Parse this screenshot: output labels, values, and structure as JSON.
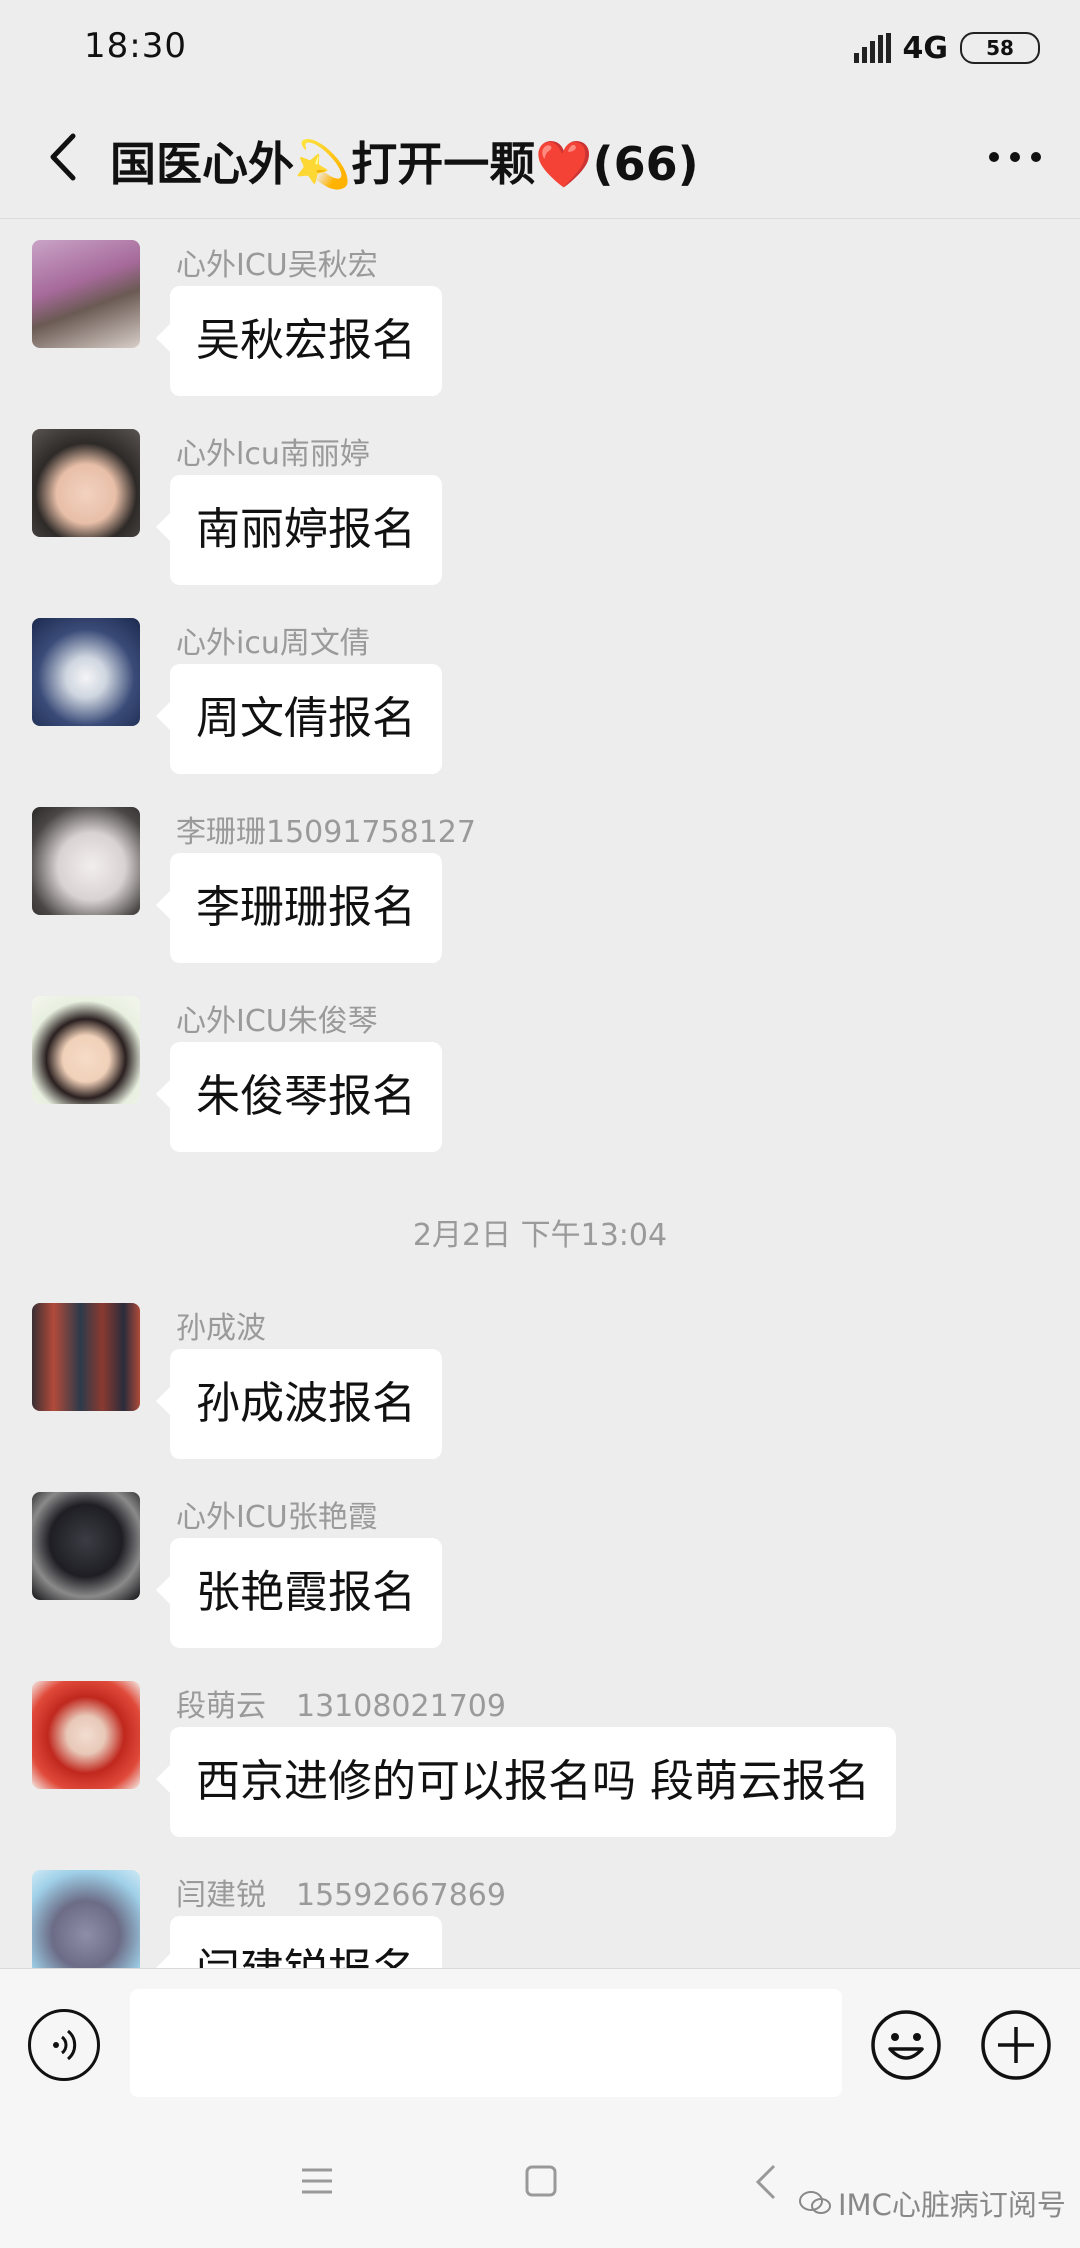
{
  "status_bar": {
    "time": "18:30",
    "network": "4G",
    "battery": "58"
  },
  "header": {
    "title": "国医心外💫打开一颗❤️(66)"
  },
  "messages": [
    {
      "sender": "心外ICU吴秋宏",
      "text": "吴秋宏报名"
    },
    {
      "sender": "心外lcu南丽婷",
      "text": "南丽婷报名"
    },
    {
      "sender": "心外icu周文倩",
      "text": "周文倩报名"
    },
    {
      "sender": "李珊珊15091758127",
      "text": "李珊珊报名"
    },
    {
      "sender": "心外ICU朱俊琴",
      "text": "朱俊琴报名"
    },
    {
      "sender": "孙成波",
      "text": "孙成波报名"
    },
    {
      "sender": "心外ICU张艳霞",
      "text": "张艳霞报名"
    },
    {
      "sender": "段萌云　13108021709",
      "text": "西京进修的可以报名吗  段萌云报名"
    },
    {
      "sender": "闫建锐　15592667869",
      "text": "闫建锐报名"
    }
  ],
  "timestamp": "2月2日 下午13:04",
  "input": {
    "placeholder": ""
  },
  "watermark": "IMC心脏病订阅号",
  "colors": {
    "background": "#ededed",
    "bubble": "#ffffff",
    "sender": "#9a9a9a"
  }
}
